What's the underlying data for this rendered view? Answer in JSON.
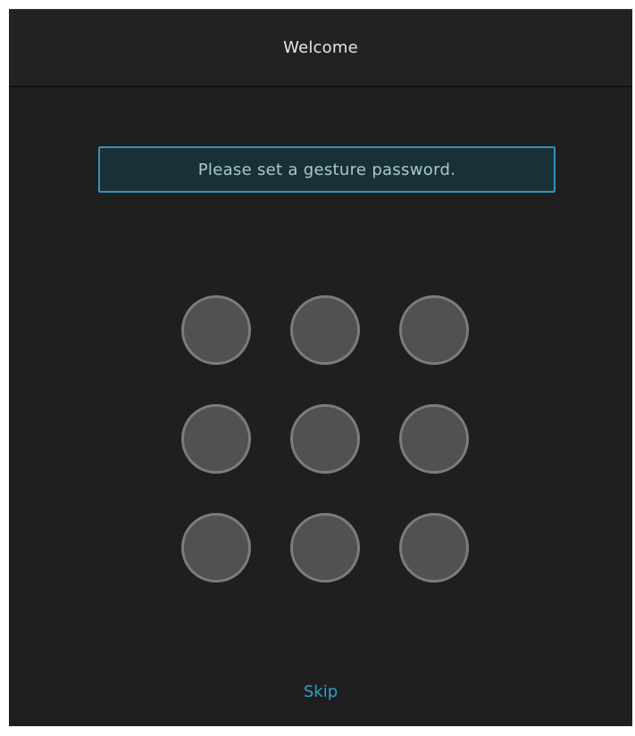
{
  "title_bar": {
    "title": "Welcome"
  },
  "prompt": {
    "text": "Please set a gesture password."
  },
  "gesture_grid": {
    "rows": 3,
    "cols": 3,
    "selected_count": 0
  },
  "footer": {
    "skip_label": "Skip"
  },
  "colors": {
    "accent": "#2f93bf",
    "background": "#1f1f1f",
    "dot_fill": "#515151",
    "dot_border": "#7c7c7c"
  }
}
